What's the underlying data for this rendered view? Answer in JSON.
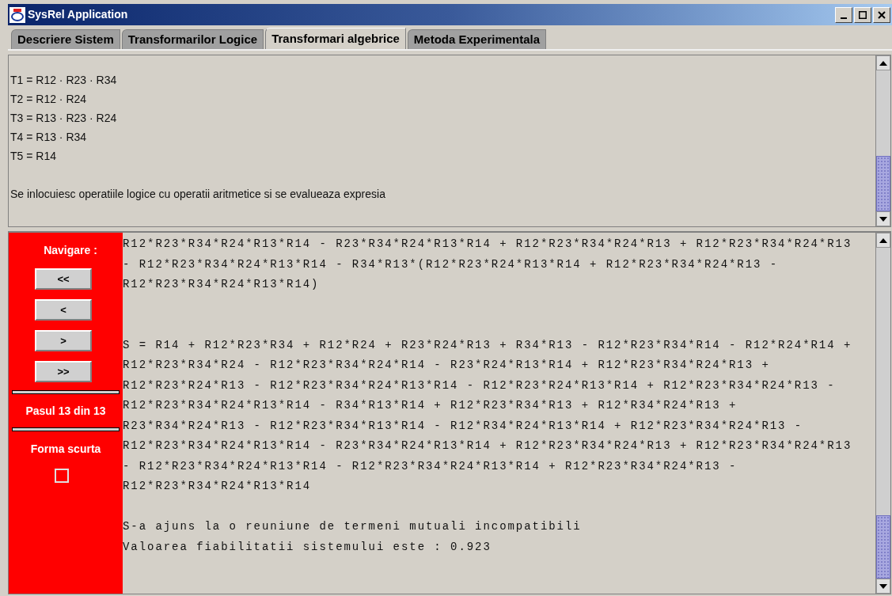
{
  "window": {
    "title": "SysRel Application"
  },
  "tabs": [
    {
      "label": "Descriere Sistem",
      "selected": false
    },
    {
      "label": "Transformarilor Logice",
      "selected": false
    },
    {
      "label": "Transformari algebrice",
      "selected": true
    },
    {
      "label": "Metoda Experimentala",
      "selected": false
    }
  ],
  "top_pane": {
    "formulas": [
      "T1 = R12 · R23 · R34",
      "T2 = R12 · R24",
      "T3 = R13 · R23 · R24",
      "T4 = R13 · R34",
      "T5 = R14"
    ],
    "note": "Se inlocuiesc operatiile logice cu operatii aritmetice si se evalueaza expresia"
  },
  "navigation": {
    "title": "Navigare :",
    "buttons": [
      "<<",
      "<",
      ">",
      ">>"
    ],
    "step": "Pasul 13 din 13",
    "short_form": {
      "label": "Forma scurta",
      "checked": false
    }
  },
  "output": {
    "blocks": [
      [
        "R12*R23*R34*R24*R13*R14 - R23*R34*R24*R13*R14 + R12*R23*R34*R24*R13 + R12*R23*R34*R24*R13",
        "- R12*R23*R34*R24*R13*R14 - R34*R13*(R12*R23*R24*R13*R14 + R12*R23*R34*R24*R13 -",
        "R12*R23*R34*R24*R13*R14)"
      ],
      [
        "S = R14 + R12*R23*R34 + R12*R24 + R23*R24*R13 + R34*R13 - R12*R23*R34*R14 - R12*R24*R14 +",
        "R12*R23*R34*R24 - R12*R23*R34*R24*R14 - R23*R24*R13*R14 + R12*R23*R34*R24*R13 +",
        "R12*R23*R24*R13 - R12*R23*R34*R24*R13*R14 - R12*R23*R24*R13*R14 + R12*R23*R34*R24*R13 -",
        "R12*R23*R34*R24*R13*R14 - R34*R13*R14 + R12*R23*R34*R13 + R12*R34*R24*R13 +",
        "R23*R34*R24*R13 - R12*R23*R34*R13*R14 - R12*R34*R24*R13*R14 + R12*R23*R34*R24*R13 -",
        "R12*R23*R34*R24*R13*R14 - R23*R34*R24*R13*R14 + R12*R23*R34*R24*R13 + R12*R23*R34*R24*R13",
        "- R12*R23*R34*R24*R13*R14 - R12*R23*R34*R24*R13*R14 + R12*R23*R34*R24*R13 -",
        "R12*R23*R34*R24*R13*R14"
      ],
      [
        "S-a ajuns la o reuniune de termeni mutuali incompatibili",
        "Valoarea fiabilitatii sistemului este : 0.923"
      ]
    ]
  }
}
